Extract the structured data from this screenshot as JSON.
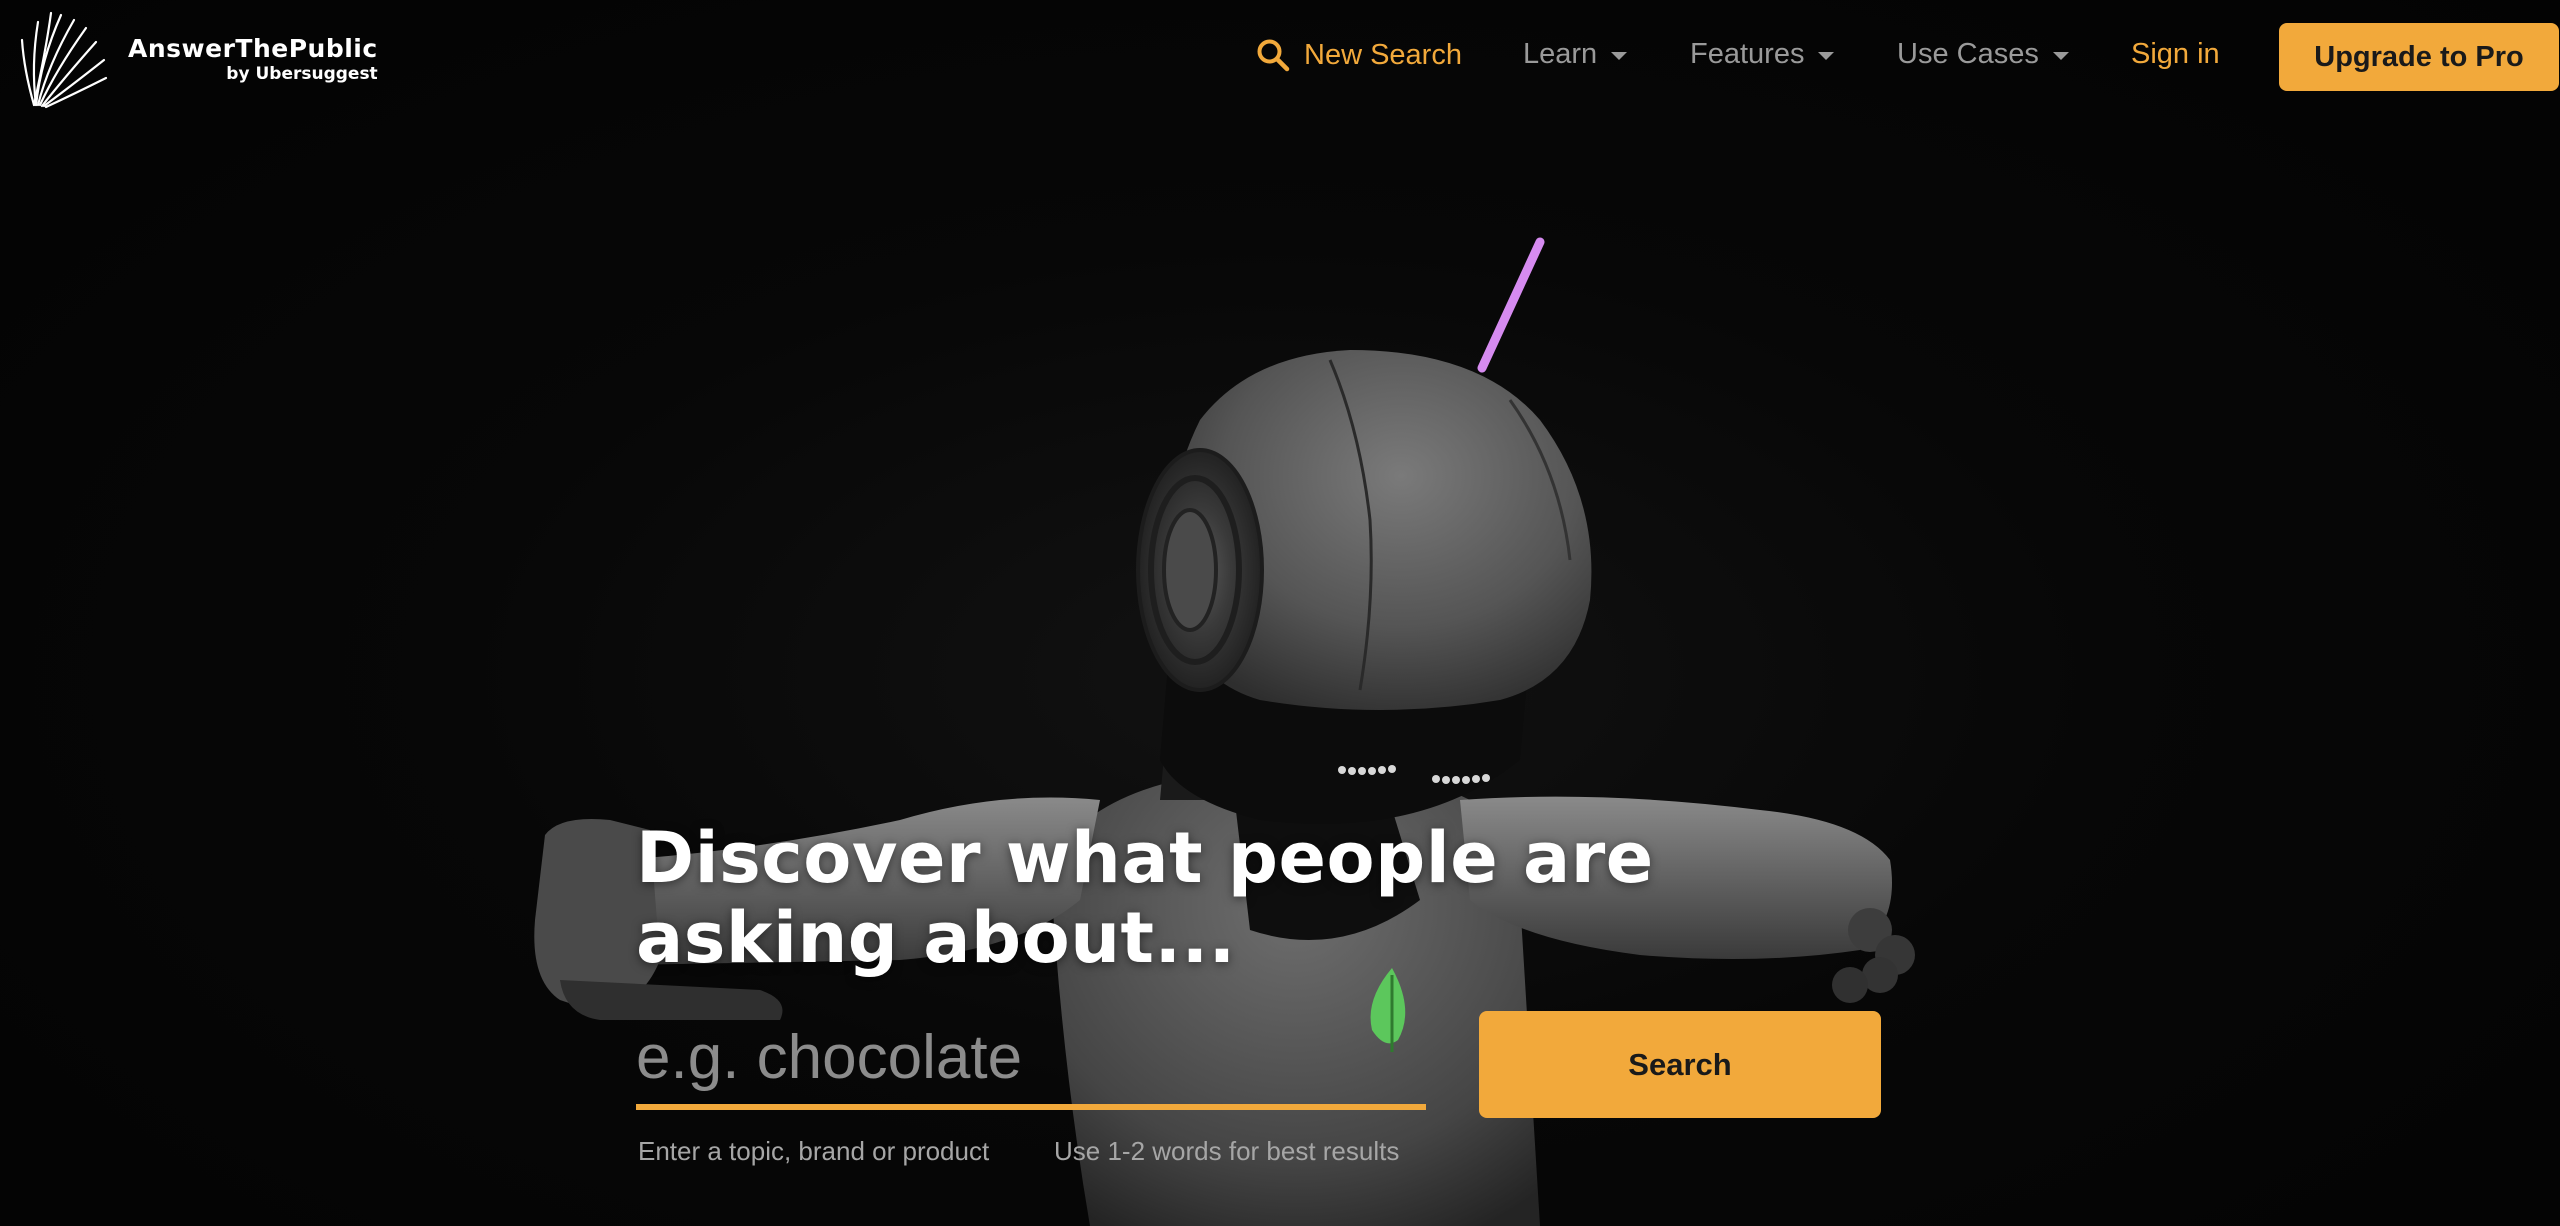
{
  "brand": {
    "name": "AnswerThePublic",
    "by": "by Ubersuggest",
    "logo_icon": "starburst-logo-icon"
  },
  "nav": {
    "new_search": "New Search",
    "learn": "Learn",
    "features": "Features",
    "use_cases": "Use Cases",
    "sign_in": "Sign in",
    "upgrade": "Upgrade to Pro"
  },
  "hero": {
    "title": "Discover what people are asking about...",
    "search_placeholder": "e.g. chocolate",
    "search_button": "Search",
    "hint_topic": "Enter a topic, brand or product",
    "hint_words": "Use 1-2 words for best results"
  },
  "colors": {
    "accent": "#f2a93b",
    "background": "#050505",
    "nav_text": "#9a9a9a",
    "antenna": "#d68bf0",
    "leaf": "#5cc75c"
  }
}
